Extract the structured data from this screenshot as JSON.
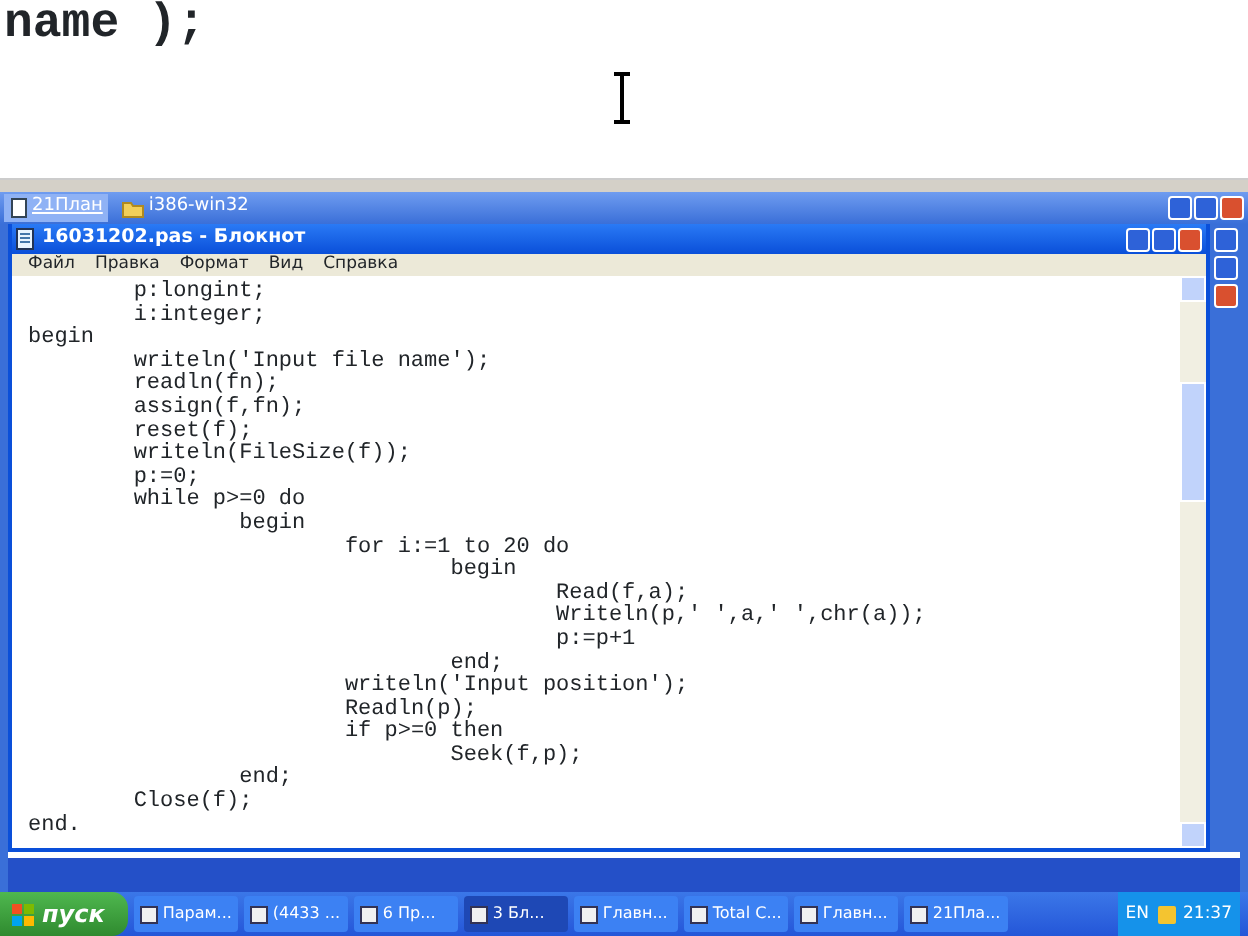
{
  "background_editor": {
    "visible_text": "name );"
  },
  "back_window": {
    "tabs": [
      {
        "label": "21План",
        "selected": true
      },
      {
        "label": "i386-win32",
        "selected": false
      }
    ]
  },
  "notepad": {
    "title": "16031202.pas - Блокнот",
    "menu": [
      "Файл",
      "Правка",
      "Формат",
      "Вид",
      "Справка"
    ],
    "lines": [
      "\tp:longint;",
      "\ti:integer;",
      "begin",
      "\twriteln('Input file name');",
      "\treadln(fn);",
      "\tassign(f,fn);",
      "\treset(f);",
      "\twriteln(FileSize(f));",
      "\tp:=0;",
      "\twhile p>=0 do",
      "\t\tbegin",
      "\t\t\tfor i:=1 to 20 do",
      "\t\t\t\tbegin",
      "\t\t\t\t\tRead(f,a);",
      "\t\t\t\t\tWriteln(p,' ',a,' ',chr(a));",
      "\t\t\t\t\tp:=p+1",
      "\t\t\t\tend;",
      "\t\t\twriteln('Input position');",
      "\t\t\tReadln(p);",
      "\t\t\tif p>=0 then",
      "\t\t\t\tSeek(f,p);",
      "\t\tend;",
      "\tClose(f);",
      "end."
    ]
  },
  "taskbar": {
    "start": "пуск",
    "items": [
      {
        "label": "Парам...",
        "selected": false
      },
      {
        "label": "(4433 ...",
        "selected": false
      },
      {
        "label": "6 Пр...",
        "selected": false
      },
      {
        "label": "3 Бл...",
        "selected": true
      },
      {
        "label": "Главн...",
        "selected": false
      },
      {
        "label": "Total C...",
        "selected": false
      },
      {
        "label": "Главн...",
        "selected": false
      },
      {
        "label": "21Пла...",
        "selected": false
      }
    ],
    "language": "EN",
    "clock": "21:37"
  }
}
